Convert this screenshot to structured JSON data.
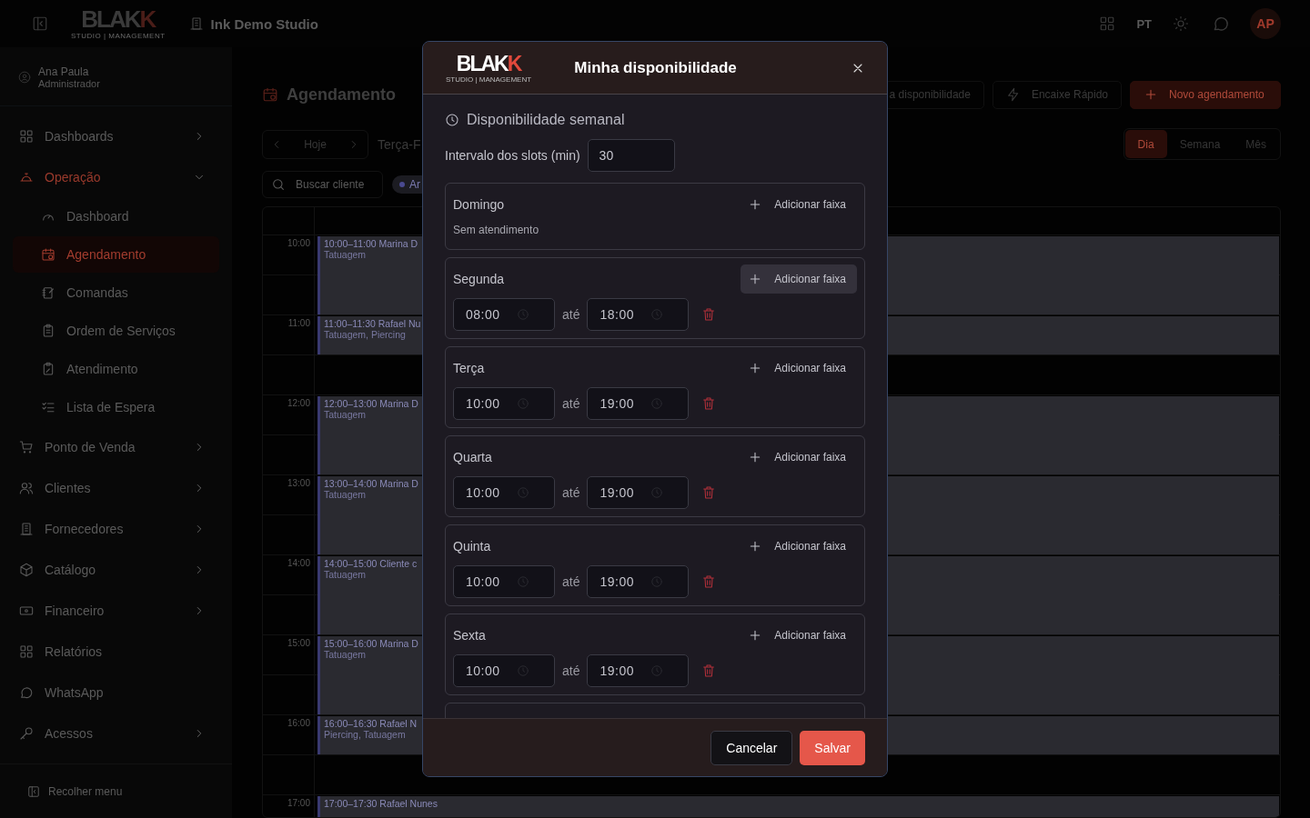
{
  "topbar": {
    "logo": {
      "main": "BLAK",
      "accent": "K",
      "tagline": "STUDIO | MANAGEMENT"
    },
    "studio": "Ink Demo Studio",
    "language": "PT",
    "avatar": "AP"
  },
  "sidebar": {
    "user": {
      "name": "Ana Paula",
      "role": "Administrador"
    },
    "items": [
      {
        "label": "Dashboards",
        "selected": false,
        "expanded": false
      },
      {
        "label": "Operação",
        "selected": true,
        "expanded": true,
        "children": [
          {
            "label": "Dashboard",
            "selected": false
          },
          {
            "label": "Agendamento",
            "selected": true
          },
          {
            "label": "Comandas",
            "selected": false
          },
          {
            "label": "Ordem de Serviços",
            "selected": false
          },
          {
            "label": "Atendimento",
            "selected": false
          },
          {
            "label": "Lista de Espera",
            "selected": false
          }
        ]
      },
      {
        "label": "Ponto de Venda",
        "selected": false,
        "expanded": false
      },
      {
        "label": "Clientes",
        "selected": false,
        "expanded": false
      },
      {
        "label": "Fornecedores",
        "selected": false,
        "expanded": false
      },
      {
        "label": "Catálogo",
        "selected": false,
        "expanded": false
      },
      {
        "label": "Financeiro",
        "selected": false,
        "expanded": false
      },
      {
        "label": "Relatórios",
        "selected": false
      },
      {
        "label": "WhatsApp",
        "selected": false
      },
      {
        "label": "Acessos",
        "selected": false,
        "expanded": false
      }
    ],
    "collapse": "Recolher menu"
  },
  "page": {
    "title": "Agendamento",
    "actions": [
      "a disponibilidade",
      "Encaixe Rápido",
      "Novo agendamento"
    ],
    "nav": {
      "today": "Hoje",
      "date": "Terça-F"
    },
    "views": [
      {
        "label": "Dia",
        "selected": true
      },
      {
        "label": "Semana",
        "selected": false
      },
      {
        "label": "Mês",
        "selected": false
      }
    ],
    "search": {
      "placeholder": "Buscar cliente"
    },
    "filter_chip": "Ar"
  },
  "calendar": {
    "hours": [
      {
        "label": "10:00",
        "events": [
          {
            "kind": "hour",
            "title": "10:00–11:00 Marina D",
            "subtitle": "Tatuagem"
          }
        ]
      },
      {
        "label": "11:00",
        "events": [
          {
            "kind": "half_hour",
            "title": "11:00–11:30 Rafael Nu",
            "subtitle": "Tatuagem, Piercing"
          }
        ]
      },
      {
        "label": "12:00",
        "events": [
          {
            "kind": "hour",
            "title": "12:00–13:00 Marina D",
            "subtitle": "Tatuagem"
          }
        ]
      },
      {
        "label": "13:00",
        "events": [
          {
            "kind": "hour",
            "title": "13:00–14:00 Marina D",
            "subtitle": "Tatuagem"
          }
        ]
      },
      {
        "label": "14:00",
        "events": [
          {
            "kind": "hour",
            "title": "14:00–15:00 Cliente c",
            "subtitle": "Tatuagem"
          }
        ]
      },
      {
        "label": "15:00",
        "events": [
          {
            "kind": "hour",
            "title": "15:00–16:00 Marina D",
            "subtitle": "Tatuagem"
          }
        ]
      },
      {
        "label": "16:00",
        "events": [
          {
            "kind": "half_hour",
            "title": "16:00–16:30 Rafael N",
            "subtitle": "Piercing, Tatuagem"
          }
        ]
      },
      {
        "label": "17:00",
        "events": [
          {
            "kind": "half_hour",
            "title": "17:00–17:30 Rafael Nunes"
          }
        ]
      }
    ]
  },
  "modal": {
    "logo": {
      "main": "BLAK",
      "accent": "K",
      "tagline": "STUDIO | MANAGEMENT"
    },
    "title": "Minha disponibilidade",
    "section": "Disponibilidade semanal",
    "interval": {
      "label": "Intervalo dos slots (min)",
      "value": "30"
    },
    "days": [
      {
        "name": "Domingo",
        "add": {
          "label": "Adicionar faixa",
          "hovered": false
        },
        "empty_text": "Sem atendimento"
      },
      {
        "name": "Segunda",
        "add": {
          "label": "Adicionar faixa",
          "hovered": true
        },
        "ranges": [
          {
            "start": "08:00",
            "separator": "até",
            "end": "18:00"
          }
        ]
      },
      {
        "name": "Terça",
        "add": {
          "label": "Adicionar faixa",
          "hovered": false
        },
        "ranges": [
          {
            "start": "10:00",
            "separator": "até",
            "end": "19:00"
          }
        ]
      },
      {
        "name": "Quarta",
        "add": {
          "label": "Adicionar faixa",
          "hovered": false
        },
        "ranges": [
          {
            "start": "10:00",
            "separator": "até",
            "end": "19:00"
          }
        ]
      },
      {
        "name": "Quinta",
        "add": {
          "label": "Adicionar faixa",
          "hovered": false
        },
        "ranges": [
          {
            "start": "10:00",
            "separator": "até",
            "end": "19:00"
          }
        ]
      },
      {
        "name": "Sexta",
        "add": {
          "label": "Adicionar faixa",
          "hovered": false
        },
        "ranges": [
          {
            "start": "10:00",
            "separator": "até",
            "end": "19:00"
          }
        ]
      }
    ],
    "buttons": {
      "cancel": "Cancelar",
      "save": "Salvar"
    }
  }
}
